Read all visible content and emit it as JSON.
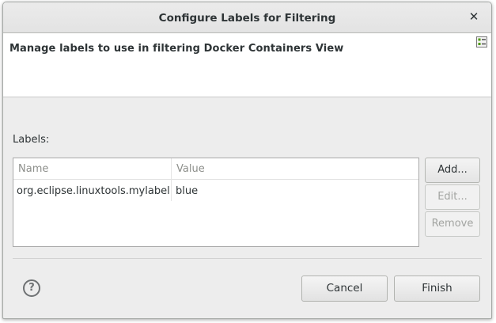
{
  "dialog": {
    "title": "Configure Labels for Filtering",
    "close_icon": "close-icon"
  },
  "header": {
    "message": "Manage labels to use in filtering Docker Containers View",
    "icon": "label-list-icon"
  },
  "labels_section": {
    "caption": "Labels:",
    "columns": [
      "Name",
      "Value"
    ],
    "rows": [
      {
        "name": "org.eclipse.linuxtools.mylabel",
        "value": "blue"
      }
    ]
  },
  "side_buttons": {
    "add": "Add...",
    "edit": "Edit...",
    "remove": "Remove"
  },
  "footer": {
    "help_icon": "help-icon",
    "help_glyph": "?",
    "cancel": "Cancel",
    "finish": "Finish"
  }
}
